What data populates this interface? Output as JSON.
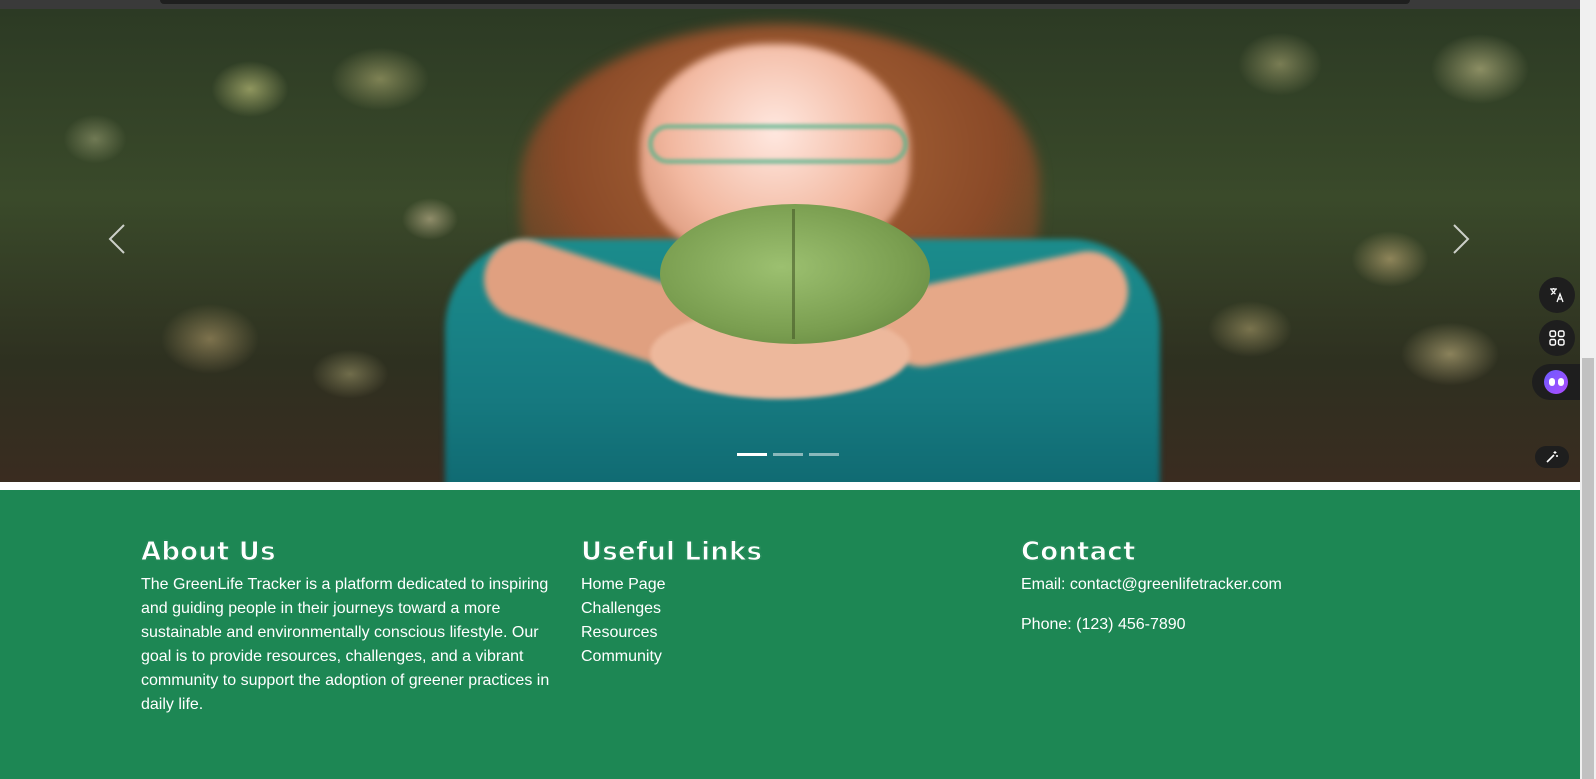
{
  "carousel": {
    "prev_icon": "chevron-left-icon",
    "next_icon": "chevron-right-icon",
    "slide_count": 3,
    "active_slide": 1,
    "image_subject": "woman holding a green leaf"
  },
  "extensions": {
    "translate_icon": "translate-icon",
    "apps_icon": "apps-grid-icon",
    "assistant_icon": "assistant-face-icon",
    "magic_icon": "magic-wand-icon"
  },
  "footer": {
    "about": {
      "title": "About Us",
      "text": "The GreenLife Tracker is a platform dedicated to inspiring and guiding people in their journeys toward a more sustainable and environmentally conscious lifestyle. Our goal is to provide resources, challenges, and a vibrant community to support the adoption of greener practices in daily life."
    },
    "links": {
      "title": "Useful Links",
      "items": [
        "Home Page",
        "Challenges",
        "Resources",
        "Community"
      ]
    },
    "contact": {
      "title": "Contact",
      "email": "Email: contact@greenlifetracker.com",
      "phone": "Phone: (123) 456-7890"
    }
  },
  "colors": {
    "footer_bg": "#1d8754",
    "footer_text": "#ffffff"
  }
}
